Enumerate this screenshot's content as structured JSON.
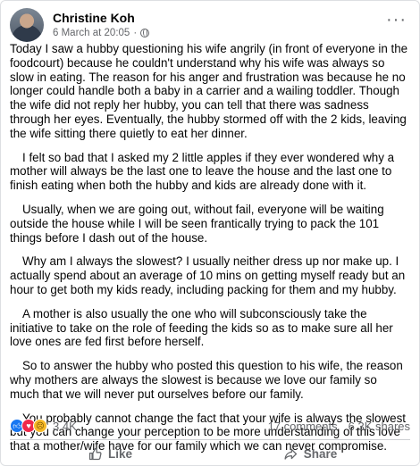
{
  "post": {
    "author": "Christine Koh",
    "timestamp": "6 March at 20:05",
    "separator": "·",
    "privacy_icon": "globe-icon",
    "more_label": "···",
    "paragraphs": [
      "Today I saw a hubby questioning his wife angrily (in front of everyone in the foodcourt) because he couldn't understand why his wife was always so slow in eating. The reason for his anger and frustration was because he no longer could handle both a baby in a carrier and a wailing toddler. Though the wife did not reply her hubby, you can tell that there was sadness through her eyes. Eventually, the hubby stormed off with the 2 kids, leaving the wife sitting there quietly to eat her dinner.",
      "I felt so bad that I asked my 2 little apples if they ever wondered why a mother will always be the last one to leave the house and the last one to finish eating when both the hubby and kids are already done with it.",
      "Usually, when we are going out, without fail, everyone will be waiting outside the house while I will be seen frantically trying to pack the 101 things before I dash out of the house.",
      "Why am I always the slowest? I usually neither dress up nor make up. I actually spend about an average of 10 mins on getting myself ready but an hour to get both my kids ready, including packing for them and my hubby.",
      "A mother is also usually the one who will subconsciously take the initiative to take on the role of feeding the kids so as to make sure all her love ones are fed first before herself.",
      "So to answer the hubby who posted this question to his wife, the reason why mothers are always the slowest is because we love our family so much that we will never put ourselves before our family.",
      "You probably cannot change the fact that your wife is always the slowest but you can change your perception to be more understanding of this love that a mother/wife have for our family which we can never compromise."
    ]
  },
  "stats": {
    "reactions_count": "3.4K",
    "reaction_icons": [
      "like-icon",
      "love-icon",
      "sad-icon"
    ],
    "comments": "17 comments",
    "shares": "6.3K shares"
  },
  "actions": {
    "like_label": "Like",
    "share_label": "Share"
  },
  "colors": {
    "like_blue": "#1877f2",
    "love_red": "#f0284a",
    "sad_yellow": "#f7b928",
    "secondary_text": "#65676b"
  }
}
